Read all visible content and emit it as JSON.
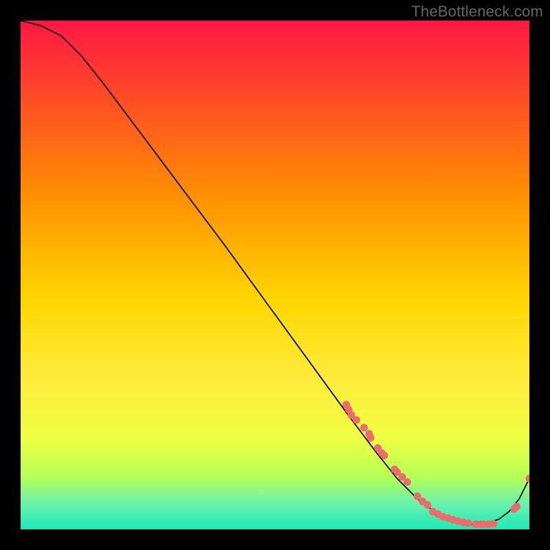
{
  "watermark": "TheBottleneck.com",
  "chart_data": {
    "type": "line",
    "title": "",
    "xlabel": "",
    "ylabel": "",
    "xlim": [
      0,
      100
    ],
    "ylim": [
      0,
      100
    ],
    "background_gradient": {
      "top": "#ff1744",
      "upper_mid": "#ff9100",
      "mid": "#ffd600",
      "lower_mid": "#eeff41",
      "bottom": "#1de9b6"
    },
    "series": [
      {
        "name": "curve",
        "style": "line",
        "color": "#000000",
        "x": [
          0,
          4,
          8,
          12,
          16,
          22,
          28,
          34,
          40,
          48,
          56,
          64,
          70,
          74,
          78,
          82,
          86,
          88,
          90,
          92,
          94,
          96,
          98,
          100
        ],
        "y": [
          100,
          99,
          97,
          93,
          88,
          80,
          72,
          64,
          56,
          45,
          34,
          23,
          15,
          10,
          6,
          3,
          1.5,
          1,
          1,
          1.3,
          2,
          3.5,
          6,
          10
        ]
      },
      {
        "name": "points",
        "style": "scatter",
        "color": "#ef6b6b",
        "x": [
          64,
          64.5,
          65,
          66,
          67.5,
          68.5,
          68.8,
          70.2,
          71,
          71.5,
          73.5,
          74,
          75,
          76,
          78,
          79,
          80,
          81,
          82,
          83,
          84,
          85,
          86,
          87,
          88,
          89.5,
          90.5,
          91,
          92,
          93,
          97,
          97.5,
          100
        ],
        "y": [
          24.5,
          23.5,
          22.5,
          21.5,
          20,
          18.8,
          18,
          16,
          15,
          14.5,
          11.8,
          11.3,
          10.3,
          9.3,
          6.5,
          5.5,
          4.8,
          3.5,
          3,
          2.5,
          2.2,
          1.9,
          1.6,
          1.4,
          1.2,
          1,
          1,
          1,
          1,
          1.1,
          4,
          4.5,
          10
        ]
      }
    ]
  }
}
